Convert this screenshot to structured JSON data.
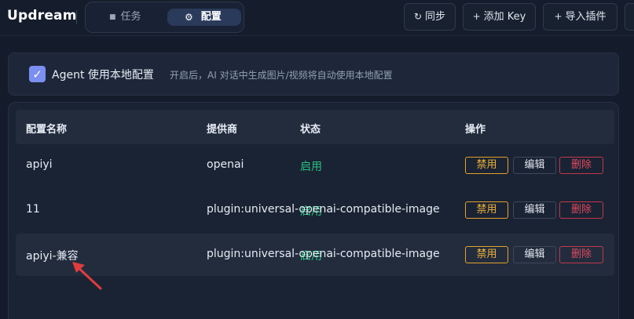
{
  "header": {
    "brand": "Updream",
    "tabs": [
      {
        "label": "任务",
        "icon": "square-icon"
      },
      {
        "label": "配置",
        "icon": "gear-icon",
        "active": true
      }
    ],
    "buttons": {
      "sync": {
        "icon": "refresh-icon",
        "label": "同步"
      },
      "add_key": {
        "icon": "plus-icon",
        "label": "添加 Key"
      },
      "import_plugin": {
        "icon": "plus-icon",
        "label": "导入插件"
      }
    }
  },
  "agent_local": {
    "checked": true,
    "label": "Agent 使用本地配置",
    "description": "开启后，AI 对话中生成图片/视频将自动使用本地配置"
  },
  "table": {
    "columns": [
      "配置名称",
      "提供商",
      "状态",
      "操作"
    ],
    "rows": [
      {
        "name": "apiyi",
        "provider": "openai",
        "status": "启用",
        "actions": [
          "禁用",
          "编辑",
          "删除"
        ]
      },
      {
        "name": "11",
        "provider": "plugin:universal-openai-compatible-image",
        "status": "启用",
        "actions": [
          "禁用",
          "编辑",
          "删除"
        ]
      },
      {
        "name": "apiyi-兼容",
        "provider": "plugin:universal-openai-compatible-image",
        "status": "启用",
        "actions": [
          "禁用",
          "编辑",
          "删除"
        ]
      }
    ]
  },
  "colors": {
    "accent_check": "#7b8ff0",
    "status_enabled": "#27c281",
    "disable_btn": "#e3a02a",
    "delete_btn": "#c4374c",
    "annotation_arrow": "#e03c3c"
  }
}
